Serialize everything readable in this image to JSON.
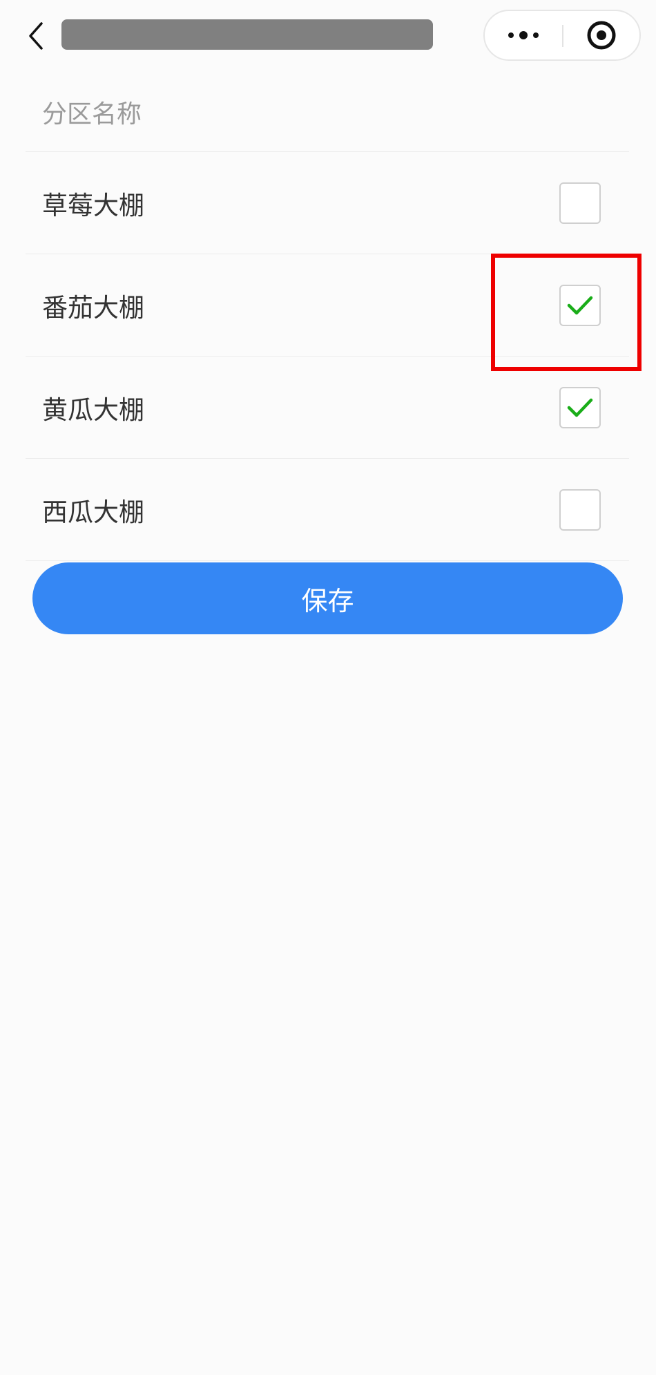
{
  "colors": {
    "background": "#fbfbfb",
    "primary": "#3587f4",
    "check": "#1aad19",
    "highlight": "#ee0000"
  },
  "nav": {
    "back_icon": "chevron-left-icon",
    "more_icon": "more-dots-icon",
    "close_icon": "target-circle-icon"
  },
  "list": {
    "header": "分区名称",
    "items": [
      {
        "label": "草莓大棚",
        "checked": false
      },
      {
        "label": "番茄大棚",
        "checked": true
      },
      {
        "label": "黄瓜大棚",
        "checked": true
      },
      {
        "label": "西瓜大棚",
        "checked": false
      }
    ]
  },
  "save_label": "保存"
}
